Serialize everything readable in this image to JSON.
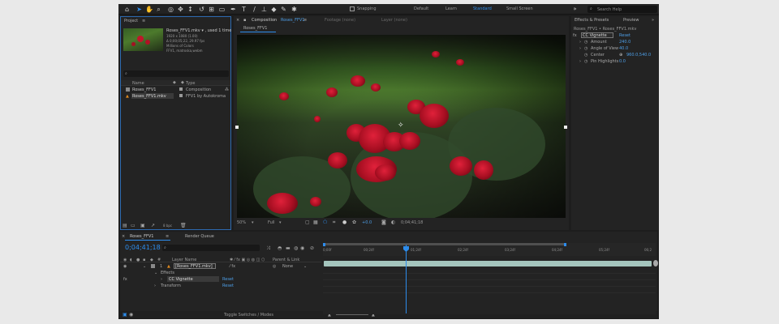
{
  "toolbar": {
    "snapping_label": "Snapping",
    "workspaces": [
      "Default",
      "Learn",
      "Standard",
      "Small Screen"
    ],
    "search_placeholder": "Search Help"
  },
  "project_panel": {
    "tab_label": "Project",
    "item_name": "Roses_FFV1.mkv ▾ , used 1 time",
    "item_info_1": "1920 x 1080 (1.00)",
    "item_info_2": "Δ 0;00;05;22, 29.97 fps",
    "item_info_3": "Millions of Colors",
    "item_info_4": "FFV1, matroska,webm",
    "col_name": "Name",
    "col_type": "Type",
    "rows": [
      {
        "name": "Roses_FFV1",
        "type": "Composition"
      },
      {
        "name": "Roses_FFV1.mkv",
        "type": "FFV1 by Autokroma"
      }
    ],
    "bpc_label": "8 bpc"
  },
  "comp_panel": {
    "tab_label": "Composition",
    "tab_comp_name": "Roses_FFV1",
    "footage_tab": "Footage (none)",
    "layer_tab": "Layer (none)",
    "subtab": "Roses_FFV1",
    "zoom": "50%",
    "resolution": "Full",
    "exposure": "+0.0",
    "timecode": "0;04;41;18"
  },
  "effects_panel": {
    "tab_label": "Effects & Presets",
    "tab2_label": "Preview",
    "header": "Roses_FFV1 • Roses_FFV1.mkv",
    "effect_name": "CC Vignette",
    "reset_label": "Reset",
    "props": [
      {
        "name": "Amount",
        "value": "240.0"
      },
      {
        "name": "Angle of View",
        "value": "40.0"
      },
      {
        "name": "Center",
        "value": "960.0,540.0"
      },
      {
        "name": "Pin Highlights",
        "value": "0.0"
      }
    ]
  },
  "timeline": {
    "comp_tab": "Roses_FFV1",
    "render_tab": "Render Queue",
    "timecode": "0;04;41;18",
    "ruler_labels": [
      "0;00f",
      "00;24f",
      "01;24f",
      "02;24f",
      "03;24f",
      "04;24f",
      "05;24f",
      "06;2"
    ],
    "col_layer_name": "Layer Name",
    "col_parent": "Parent & Link",
    "layer_index": "1",
    "layer_name": "[Roses_FFV1.mkv]",
    "parent_value": "None",
    "effects_label": "Effects",
    "effect_name": "CC Vignette",
    "effect_reset": "Reset",
    "transform_label": "Transform",
    "transform_reset": "Reset",
    "toggle_label": "Toggle Switches / Modes"
  }
}
